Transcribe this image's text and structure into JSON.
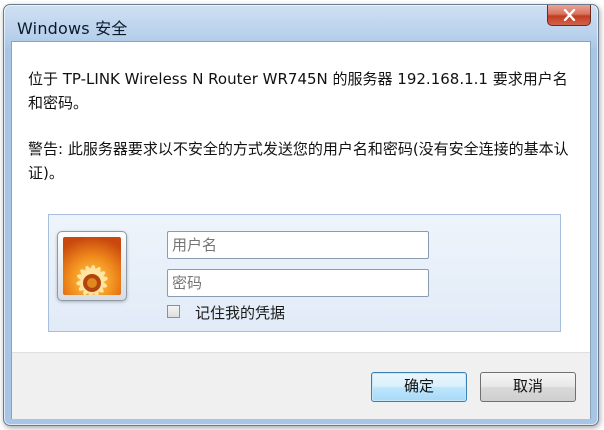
{
  "window": {
    "title": "Windows 安全"
  },
  "message": {
    "line1": "位于 TP-LINK Wireless N Router WR745N 的服务器 192.168.1.1 要求用户名和密码。",
    "line2": "警告: 此服务器要求以不安全的方式发送您的用户名和密码(没有安全连接的基本认证)。"
  },
  "credentials": {
    "username": {
      "placeholder": "用户名",
      "value": ""
    },
    "password": {
      "placeholder": "密码",
      "value": ""
    },
    "remember_label": "记住我的凭据",
    "remember_checked": false
  },
  "buttons": {
    "ok_label": "确定",
    "cancel_label": "取消"
  },
  "colors": {
    "title_bar": "#b9d1ec",
    "close_button": "#c23d22",
    "panel_background": "#e6eef8",
    "default_button_border": "#3c7fb1"
  },
  "icons": {
    "close": "close-icon",
    "avatar": "user-avatar-flower-icon",
    "checkbox": "checkbox-icon"
  }
}
